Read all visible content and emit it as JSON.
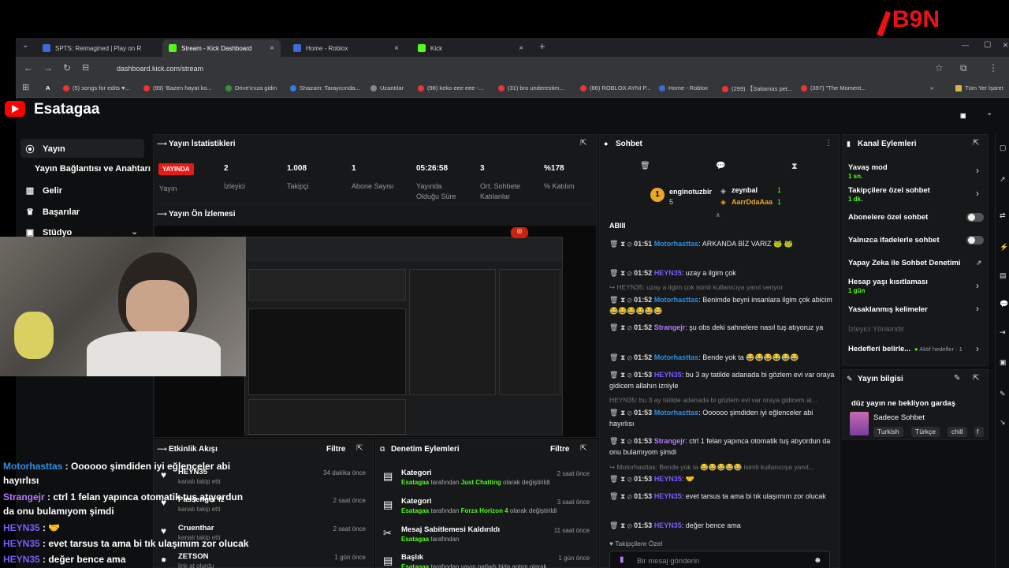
{
  "overlay_logo": "B9N",
  "browser": {
    "tabs": [
      {
        "label": "SPTS: Reimagined | Play on R"
      },
      {
        "label": "Stream - Kick Dashboard"
      },
      {
        "label": "Home - Roblox"
      },
      {
        "label": "Kick"
      }
    ],
    "url": "dashboard.kick.com/stream",
    "bookmarks": [
      "(5) songs for edits ♥...",
      "(99) 'Bazen hayat ko...",
      "Drive'ınıza gidin",
      "Shazam: Tarayıcında...",
      "Uzantılar",
      "(98) keko eee eee -...",
      "(31) bro underestim...",
      "(86) ROBLOX AYNI P...",
      "Home - Roblox",
      "(299) 【Saitamas pet...",
      "(397) \"The Moment...",
      "Tüm Yer İşaret"
    ]
  },
  "channel_name": "Esatagaa",
  "sidebar": {
    "items": [
      {
        "label": "Yayın"
      },
      {
        "label": "Yayın Bağlantısı ve Anahtarı"
      },
      {
        "label": "Gelir"
      },
      {
        "label": "Başarılar"
      },
      {
        "label": "Stüdyo"
      }
    ]
  },
  "stats": {
    "title": "Yayın İstatistikleri",
    "live_badge": "YAYINDA",
    "live_label": "Yayın",
    "items": [
      {
        "value": "2",
        "label": "İzleyici"
      },
      {
        "value": "1.008",
        "label": "Takipçi"
      },
      {
        "value": "1",
        "label": "Abone Sayısı"
      },
      {
        "value": "05:26:58",
        "label": "Yayında Olduğu Süre"
      },
      {
        "value": "3",
        "label": "Ort. Sohbete Katılanlar"
      },
      {
        "value": "%178",
        "label": "% Katılım"
      }
    ]
  },
  "preview_title": "Yayın Ön İzlemesi",
  "chat": {
    "title": "Sohbet",
    "top_users": [
      {
        "name": "enginotuzbir",
        "count": "5"
      },
      {
        "name": "zeynbal",
        "count": "1"
      },
      {
        "name": "AarrDdaAaa",
        "count": "1"
      }
    ],
    "header_user": "ABIII",
    "messages": [
      {
        "time": "01:51",
        "user": "Motorhasttas",
        "text": ": ARKANDA BİZ VARIZ 🐸 🐸"
      },
      {
        "time": "01:52",
        "user": "HEYN35",
        "text": ": uzay a ilgim çok"
      },
      {
        "sys": "↪ HEYN35: uzay a ilgim çok isimli kullanıcıya yanıt veriyor"
      },
      {
        "time": "01:52",
        "user": "Motorhasttas",
        "text": ": Benimde beyni insanlara ilgim çok abicim 😂😂😂😂😂😂"
      },
      {
        "time": "01:52",
        "user": "Strangejr",
        "text": ": şu obs deki sahnelere nasıl tuş atıyoruz ya"
      },
      {
        "time": "01:52",
        "user": "Motorhasttas",
        "text": ": Bende yok ta 😂😂😂😂😂😂"
      },
      {
        "time": "01:53",
        "user": "HEYN35",
        "text": ": bu 3 ay tatilde adanada bi gözlem evi var oraya gidicem allahın izniyle"
      },
      {
        "sys": "HEYN35: bu 3 ay tatilde adanada bi gözlem evi var oraya gidicem al..."
      },
      {
        "time": "01:53",
        "user": "Motorhasttas",
        "text": ": Oooooo şimdiden iyi eğlenceler abi hayırlısı"
      },
      {
        "time": "01:53",
        "user": "Strangejr",
        "text": ": ctrl 1 felan yapınca otomatik tuş atıyordun da onu bulamıyom şimdi"
      },
      {
        "sys": "↪ Motorhasttas: Bende yok ta 😂😂😂😂😂 isimli kullanıcıya yanıt..."
      },
      {
        "time": "01:53",
        "user": "HEYN35",
        "text": ": 🤝"
      },
      {
        "time": "01:53",
        "user": "HEYN35",
        "text": ": evet tarsus ta ama bi tık ulaşımım zor olucak"
      },
      {
        "time": "01:53",
        "user": "HEYN35",
        "text": ": değer bence ama"
      }
    ],
    "mode_label": "Takipçilere Özel",
    "input_placeholder": "Bir mesaj gönderin"
  },
  "kanal": {
    "title": "Kanal Eylemleri",
    "items": [
      {
        "label": "Yavaş mod",
        "sub": "1 sn."
      },
      {
        "label": "Takipçilere özel sohbet",
        "sub": "1 dk."
      },
      {
        "label": "Abonelere özel sohbet"
      },
      {
        "label": "Yalnızca ifadelerle sohbet"
      },
      {
        "label": "Yapay Zeka ile Sohbet Denetimi"
      },
      {
        "label": "Hesap yaşı kısıtlaması",
        "sub": "1 gün"
      },
      {
        "label": "Yasaklanmış kelimeler"
      },
      {
        "label": "İzleyici Yönlendir"
      },
      {
        "label": "Hedefleri belirle...",
        "sub": "Aktif hedefler · 1"
      }
    ]
  },
  "yayin_bilgisi": {
    "title": "Yayın bilgisi",
    "stream_title": "düz yayın ne bekliyon gardaş",
    "category": "Sadece Sohbet",
    "tags": [
      "Turkish",
      "Türkçe",
      "chill",
      "f"
    ]
  },
  "etkinlik": {
    "title": "Etkinlik Akışı",
    "filter": "Filtre",
    "items": [
      {
        "name": "HEYN35",
        "sub": "kanalı takip etti",
        "time": "34 dakika önce"
      },
      {
        "name": "Passenger fz",
        "sub": "kanalı takip etti",
        "time": "2 saat önce"
      },
      {
        "name": "Cruenthar",
        "sub": "kanalı takip etti",
        "time": "2 saat önce"
      },
      {
        "name": "ZETSON",
        "sub": "link at olurdu",
        "time": "1 gün önce"
      }
    ]
  },
  "denetim": {
    "title": "Denetim Eylemleri",
    "filter": "Filtre",
    "items": [
      {
        "name": "Kategori",
        "by": "Esatagaa",
        "mid": " tarafından ",
        "cat": "Just Chatting",
        "end": " olarak değiştirildi",
        "time": "2 saat önce"
      },
      {
        "name": "Kategori",
        "by": "Esatagaa",
        "mid": " tarafından ",
        "cat": "Forza Horizon 4",
        "end": " olarak değiştirildi",
        "time": "3 saat önce"
      },
      {
        "name": "Mesaj Sabitlemesi Kaldırıldı",
        "by": "Esatagaa",
        "mid": " tarafından",
        "cat": "",
        "end": "",
        "time": "11 saat önce"
      },
      {
        "name": "Başlık",
        "by": "Esatagaa",
        "mid": " tarafından yayın patladı bida aqtım olarak",
        "cat": "",
        "end": "",
        "time": "1 gün önce"
      }
    ]
  },
  "overlay_chat": [
    {
      "user": "Motorhasttas",
      "text": " : Oooooo şimdiden iyi eğlenceler abi"
    },
    {
      "user": "",
      "text": "hayırlısı"
    },
    {
      "user": "Strangejr",
      "text": " : ctrl 1 felan yapınca otomatik tuş atıyordun"
    },
    {
      "user": "",
      "text": "da onu bulamıyom şimdi"
    },
    {
      "user": "HEYN35",
      "text": " : 🤝"
    },
    {
      "user": "HEYN35",
      "text": " : evet tarsus ta ama bi tık ulaşımım zor olucak"
    },
    {
      "user": "HEYN35",
      "text": " : değer bence ama"
    }
  ]
}
